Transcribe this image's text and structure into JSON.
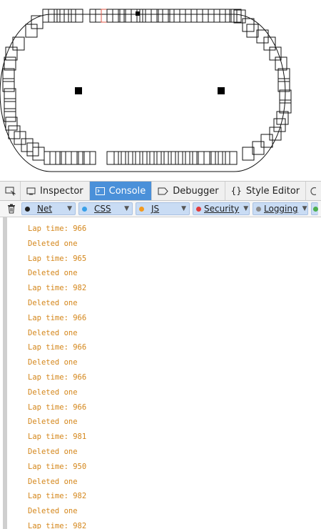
{
  "devtools": {
    "tabs": [
      {
        "label": "Inspector",
        "icon": "inspector-icon"
      },
      {
        "label": "Console",
        "icon": "console-icon"
      },
      {
        "label": "Debugger",
        "icon": "debugger-icon"
      },
      {
        "label": "Style Editor",
        "icon": "braces-icon"
      }
    ],
    "selected_tab": "Console",
    "filters": [
      {
        "label": "Net",
        "color": "#222222"
      },
      {
        "label": "CSS",
        "color": "#3aa0e8"
      },
      {
        "label": "JS",
        "color": "#f39a1f"
      },
      {
        "label": "Security",
        "color": "#e23b3b"
      },
      {
        "label": "Logging",
        "color": "#8a8a8a"
      }
    ]
  },
  "console": {
    "lines": [
      "Lap time: 966",
      "Deleted one",
      "Lap time: 965",
      "Deleted one",
      "Lap time: 982",
      "Deleted one",
      "Lap time: 966",
      "Deleted one",
      "Lap time: 966",
      "Deleted one",
      "Lap time: 966",
      "Deleted one",
      "Lap time: 966",
      "Deleted one",
      "Lap time: 981",
      "Deleted one",
      "Lap time: 950",
      "Deleted one",
      "Lap time: 982",
      "Deleted one",
      "Lap time: 982"
    ],
    "text_color": "#d4861a"
  }
}
